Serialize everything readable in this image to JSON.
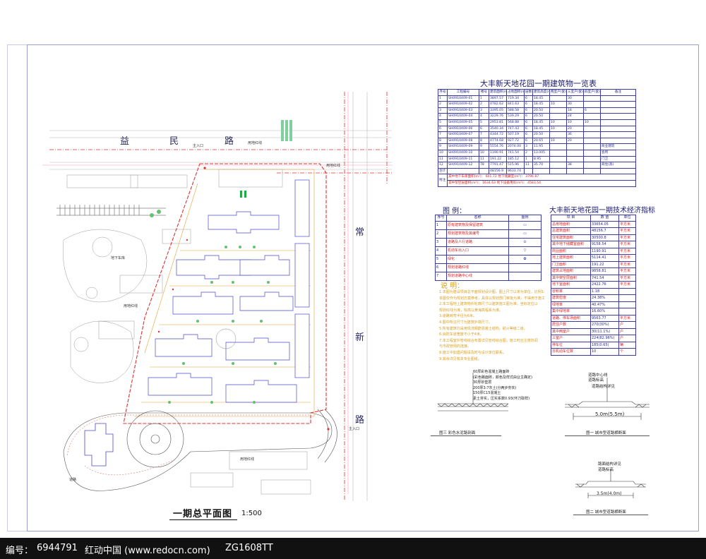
{
  "watermark": {
    "id_label": "编号：",
    "id_value": "6944791",
    "site": "红动中国 (www.redocn.com)",
    "code": "ZG1608TT"
  },
  "plan": {
    "title": "一期总平面图",
    "scale": "1:500",
    "roads": {
      "north": [
        "益",
        "民",
        "路"
      ],
      "east": [
        "常",
        "新",
        "路"
      ]
    },
    "labels": {
      "main_entrance_n": "主入口",
      "main_entrance_e": "主入口",
      "site_line_1": "用地红线",
      "site_line_2": "用地红线",
      "site_line_3": "用地红线",
      "site_line_4": "用地红线",
      "flower_1": "地下车库",
      "daolu": "道路"
    }
  },
  "building_table": {
    "title": "大丰新天地花园一期建筑物一览表",
    "headers": [
      "序号",
      "工程编号",
      "楼号",
      "建筑面积(m²)",
      "占地面积(m²)",
      "层数",
      "建筑高度(m)",
      "两室户(套)",
      "三室户(套)",
      "四室户(套)",
      "备注"
    ],
    "rows": [
      [
        "1",
        "SH0910409-01",
        "1",
        "3897.57",
        "719.34",
        "6",
        "18.45",
        "",
        "30",
        "",
        ""
      ],
      [
        "2",
        "SH0910409-02",
        "2",
        "4782.62",
        "841.63",
        "6",
        "18.45",
        "10",
        "30",
        "",
        ""
      ],
      [
        "3",
        "SH0910409-03",
        "3",
        "3395.05",
        "588.58",
        "6",
        "20.50",
        "",
        "18",
        "6",
        ""
      ],
      [
        "4",
        "SH0910409-04",
        "4",
        "3229.76",
        "539.29",
        "6",
        "20.50",
        "",
        "24",
        "",
        ""
      ],
      [
        "5",
        "SH0910409-05",
        "5",
        "2953.81",
        "568.88",
        "6",
        "18.45",
        "10",
        "10",
        "10",
        ""
      ],
      [
        "6",
        "SH0910409-06",
        "6",
        "3540.34",
        "747.43",
        "6",
        "18.45",
        "10",
        "20",
        "",
        ""
      ],
      [
        "7",
        "SH0910409-07",
        "7",
        "4344.72",
        "507.19",
        "6",
        "20.50",
        "",
        "36",
        "",
        ""
      ],
      [
        "8",
        "SH0910409-08",
        "8",
        "4774.68",
        "927.72",
        "6",
        "20.65",
        "10",
        "20",
        "",
        ""
      ],
      [
        "9",
        "SH0910409-09",
        "9",
        "5554.76",
        "2074.00",
        "3",
        "11.95",
        "",
        "",
        "",
        "商业建筑"
      ],
      [
        "10",
        "SH0910409-10",
        "10",
        "1190.91",
        "741.54",
        "2",
        "13.005",
        "",
        "",
        "",
        "会所"
      ],
      [
        "11",
        "SH0910409-11",
        "11",
        "191.22",
        "185.12",
        "1",
        "8.95",
        "",
        "",
        "",
        "门卫"
      ],
      [
        "12",
        "SH0910409-12",
        "78",
        "7791.47",
        "515.96",
        "11",
        "35.70",
        "",
        "38",
        "",
        "商住(高)"
      ],
      [
        "合计",
        "",
        "",
        "48156.9",
        "9633.74",
        "",
        "",
        "",
        "",
        "",
        ""
      ]
    ],
    "footnote_label": "附注",
    "footnotes": [
      "其中地下车库面积(m²)：  601.72   地下储藏室(m²)：  3796.87",
      "其中架空层面积(m²)：  1634.63   地下设备用房(m²)：  4583.54"
    ]
  },
  "legend": {
    "title": "图    例：",
    "headers": [
      "序号",
      "名称",
      "图例"
    ],
    "rows": [
      [
        "1",
        "原有建筑物及保留建筑",
        "▭"
      ],
      [
        "2",
        "规划建筑物及其编号",
        "▭"
      ],
      [
        "3",
        "道路及人行道路",
        "⊙"
      ],
      [
        "4",
        "机动车出入口",
        "▽"
      ],
      [
        "5",
        "绿化",
        "✿"
      ],
      [
        "6",
        "规划道路红线",
        ""
      ],
      [
        "7",
        "规划道路中心线",
        ""
      ]
    ]
  },
  "econ_table": {
    "title": "大丰新天地花园一期技术经济指标",
    "headers": [
      "项    目",
      "数    值",
      "单位"
    ],
    "rows": [
      [
        "总用地面积",
        "33654.05",
        "平方米"
      ],
      [
        "总建筑面积",
        "48156.7",
        "平方米"
      ],
      [
        "住宅建筑面积",
        "30500.8",
        "平方米"
      ],
      [
        "其中地下储藏室面积",
        "9158.54",
        "平方米"
      ],
      [
        "商业面积",
        "1190.91",
        "平方米"
      ],
      [
        "地上建筑面积",
        "5114.41",
        "平方米"
      ],
      [
        "门卫面积",
        "191.22",
        "平方米"
      ],
      [
        "建筑占地面积",
        "9858.81",
        "平方米"
      ],
      [
        "其中架空层面积",
        "741.54",
        "平方米"
      ],
      [
        "地下室面积",
        "2422.76",
        "平方米"
      ],
      [
        "容积率",
        "1.18",
        ""
      ],
      [
        "建筑密度",
        "24.38%",
        ""
      ],
      [
        "绿地率",
        "40.47%",
        ""
      ],
      [
        "集中绿地率",
        "16.60%",
        ""
      ],
      [
        "道路、停车场面积",
        "9563.77",
        "平方米"
      ],
      [
        "居住户数",
        "270(30%)",
        "户"
      ],
      [
        "其中两室户",
        "30(11.1%)",
        "户"
      ],
      [
        "三室户",
        "224(82.96%)",
        "户"
      ],
      [
        "停车位",
        "185(0.65)",
        "辆"
      ],
      [
        "非机动车位数",
        "10",
        "个"
      ]
    ]
  },
  "notes": {
    "title": "说    明：",
    "items": [
      "1.本图为建设项目总平面规划设计图，图上尺寸以米为单位，比例1:1000",
      "  本图仅作为规划方案参考，具体以规划部门审批为准，不得用于施工。",
      "2.本工程地上建筑物外轮廓尺寸以建筑施工图为准，坐标定位以",
      "  规划红线为准，标高以黄海高程系为准。",
      "3.道路转弯半径为6米。",
      "4.图中所注尺寸为建筑外墙尺寸。",
      "5.所有建筑均采用现浇钢筋混凝土结构，耐火等级二级。",
      "6.消防车道宽度不小于4米。",
      "7.本工程室外管线综合布置详见管线综合图，施工时应注意协调",
      "  与市政管网的连接。",
      "8.施工中如遇问题请及时与设计单位联系。",
      "9.其余详见有关专业图纸。"
    ]
  },
  "sections": {
    "s3": {
      "caption": "图三 彩色水泥路剖面",
      "layers": [
        "60厚彩色混凝土路面砖",
        "(彩色路面砖，颜色及样式由业主确定)",
        "30厚砂垫层",
        "200厚3:7灰土(分两步夯实)",
        "150厚C15混凝土",
        "素土夯实，压实系数0.93(环刀取样)"
      ]
    },
    "s1": {
      "caption": "图一 城市型道路横断面",
      "width": "5.0m(5.5m)",
      "notes": [
        "道路中心线",
        "道路标高",
        "道路结构详见"
      ]
    },
    "s2": {
      "caption": "图二 城市型道路横断面",
      "width": "3.5m(4.0m)",
      "notes": [
        "路面结构详见",
        "道路标高"
      ]
    }
  }
}
